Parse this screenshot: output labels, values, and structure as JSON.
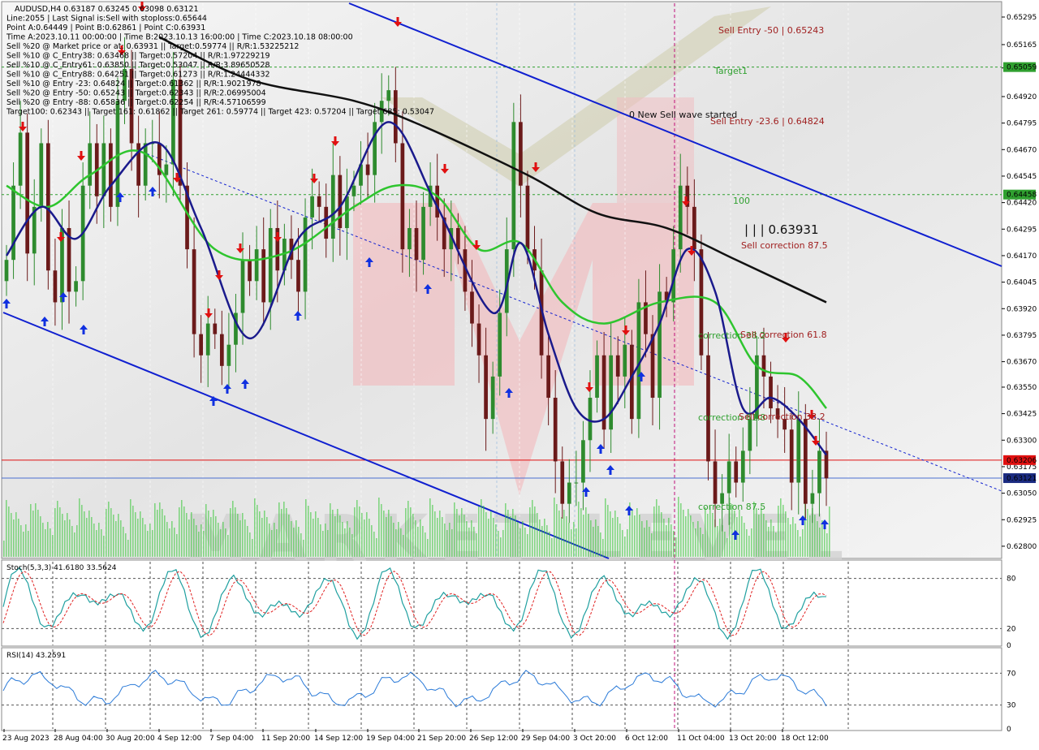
{
  "colors": {
    "bull": "#2e8b2e",
    "bear": "#6b1a1a",
    "ma_fast": "#1a1a8c",
    "ma_mid": "#2ec52e",
    "ma_slow": "#111111",
    "channel": "#1020d0",
    "sell_arrow": "#e01010",
    "buy_arrow": "#1030e0",
    "level_red": "#e01010",
    "level_blue": "#4a6fd0",
    "level_green": "#30a030",
    "ann_red": "#a02020",
    "ann_green": "#30a030"
  },
  "chart_data": {
    "type": "candlestick",
    "symbol": "AUDUSD",
    "timeframe": "H4",
    "price_axis": {
      "max": 0.6536,
      "min": 0.6275,
      "ticks": [
        "0.65295",
        "0.65165",
        "0.65055",
        "0.64920",
        "0.64795",
        "0.64670",
        "0.64545",
        "0.64420",
        "0.64295",
        "0.64170",
        "0.64045",
        "0.63920",
        "0.63795",
        "0.63670",
        "0.63550",
        "0.63425",
        "0.63300",
        "0.63175",
        "0.63050",
        "0.62925",
        "0.62800"
      ]
    },
    "x_labels": [
      "23 Aug 2023",
      "28 Aug 04:00",
      "30 Aug 20:00",
      "4 Sep 12:00",
      "7 Sep 04:00",
      "11 Sep 20:00",
      "14 Sep 12:00",
      "19 Sep 04:00",
      "21 Sep 20:00",
      "26 Sep 12:00",
      "29 Sep 04:00",
      "3 Oct 20:00",
      "6 Oct 12:00",
      "11 Oct 04:00",
      "13 Oct 20:00",
      "18 Oct 12:00"
    ],
    "closes": [
      0.6415,
      0.645,
      0.6475,
      0.6418,
      0.644,
      0.647,
      0.641,
      0.6395,
      0.643,
      0.64,
      0.6405,
      0.645,
      0.647,
      0.6445,
      0.647,
      0.644,
      0.649,
      0.6505,
      0.647,
      0.645,
      0.647,
      0.647,
      0.6455,
      0.646,
      0.65,
      0.645,
      0.642,
      0.638,
      0.637,
      0.6385,
      0.638,
      0.6365,
      0.6375,
      0.639,
      0.6415,
      0.6405,
      0.642,
      0.6395,
      0.643,
      0.641,
      0.6425,
      0.6415,
      0.64,
      0.6435,
      0.6445,
      0.644,
      0.6425,
      0.6455,
      0.643,
      0.6445,
      0.645,
      0.646,
      0.6455,
      0.648,
      0.649,
      0.6495,
      0.647,
      0.642,
      0.643,
      0.6415,
      0.644,
      0.645,
      0.6435,
      0.642,
      0.643,
      0.642,
      0.64,
      0.6385,
      0.637,
      0.634,
      0.636,
      0.639,
      0.642,
      0.648,
      0.645,
      0.642,
      0.641,
      0.637,
      0.635,
      0.632,
      0.63,
      0.631,
      0.631,
      0.633,
      0.635,
      0.637,
      0.6335,
      0.637,
      0.636,
      0.6375,
      0.634,
      0.6395,
      0.638,
      0.635,
      0.64,
      0.6395,
      0.642,
      0.645,
      0.644,
      0.642,
      0.637,
      0.632,
      0.63,
      0.6305,
      0.632,
      0.631,
      0.6325,
      0.634,
      0.637,
      0.636,
      0.6345,
      0.634,
      0.6335,
      0.631,
      0.634,
      0.63,
      0.6305,
      0.6325,
      0.6312
    ],
    "ma_fast_anchors": [
      [
        0,
        0.6417
      ],
      [
        5,
        0.644
      ],
      [
        10,
        0.6425
      ],
      [
        15,
        0.645
      ],
      [
        22,
        0.647
      ],
      [
        28,
        0.643
      ],
      [
        35,
        0.6378
      ],
      [
        42,
        0.6425
      ],
      [
        48,
        0.644
      ],
      [
        55,
        0.648
      ],
      [
        62,
        0.644
      ],
      [
        70,
        0.639
      ],
      [
        74,
        0.6423
      ],
      [
        78,
        0.638
      ],
      [
        82,
        0.6345
      ],
      [
        86,
        0.634
      ],
      [
        90,
        0.636
      ],
      [
        94,
        0.6385
      ],
      [
        98,
        0.642
      ],
      [
        102,
        0.64
      ],
      [
        106,
        0.6345
      ],
      [
        110,
        0.635
      ],
      [
        114,
        0.634
      ],
      [
        118,
        0.6323
      ]
    ],
    "ma_mid_anchors": [
      [
        0,
        0.645
      ],
      [
        6,
        0.644
      ],
      [
        12,
        0.6455
      ],
      [
        20,
        0.6465
      ],
      [
        30,
        0.642
      ],
      [
        40,
        0.6418
      ],
      [
        50,
        0.644
      ],
      [
        56,
        0.645
      ],
      [
        62,
        0.6445
      ],
      [
        68,
        0.642
      ],
      [
        74,
        0.6423
      ],
      [
        80,
        0.6395
      ],
      [
        86,
        0.6385
      ],
      [
        94,
        0.6395
      ],
      [
        102,
        0.6395
      ],
      [
        108,
        0.6365
      ],
      [
        114,
        0.636
      ],
      [
        118,
        0.6345
      ]
    ],
    "ma_slow_anchors": [
      [
        22,
        0.652
      ],
      [
        35,
        0.65
      ],
      [
        50,
        0.649
      ],
      [
        60,
        0.6478
      ],
      [
        75,
        0.6455
      ],
      [
        85,
        0.6437
      ],
      [
        95,
        0.643
      ],
      [
        105,
        0.6415
      ],
      [
        118,
        0.6395
      ]
    ],
    "info_lines": [
      "AUDUSD,H4  0.63187 0.63245 0.63098 0.63121",
      "Line:2055 | Last Signal is:Sell with stoploss:0.65644",
      "Point A:0.64449 | Point B:0.62861 | Point C:0.63931",
      "Time A:2023.10.11 00:00:00 | Time B:2023.10.13 16:00:00 | Time C:2023.10.18 08:00:00",
      "Sell %20 @ Market price or at: 0.63931 || Target:0.59774 || R/R:1.53225212",
      "Sell %10 @ C_Entry38: 0.63468 || Target:0.57204 || R/R:1.97229219",
      "Sell %10 @ C_Entry61: 0.63850 || Target:0.53047 || R/R:3.89650528",
      "Sell %10 @ C_Entry88: 0.64251 || Target:0.61273 || R/R:1.24444332",
      "Sell %10 @ Entry -23: 0.64824 || Target:0.61362 || R/R:1.9021978",
      "Sell %20 @ Entry -50: 0.65243 || Target:0.62343 || R/R:2.06995004",
      "Sell %20 @ Entry -88: 0.65836 || Target:0.62254 || R/R:4.57106599",
      "Target100: 0.62343 || Target 161: 0.61862 || Target 261: 0.59774 || Target 423: 0.57204 || Target 685: 0.53047"
    ],
    "annotations": [
      {
        "text": "Sell Entry -50 | 0.65243",
        "color": "red"
      },
      {
        "text": "Target1",
        "color": "green"
      },
      {
        "text": "0 New Sell wave started",
        "color": "black"
      },
      {
        "text": "Sell Entry -23.6 | 0.64824",
        "color": "red"
      },
      {
        "text": "100",
        "color": "green"
      },
      {
        "text": "| | | 0.63931",
        "color": "black"
      },
      {
        "text": "Sell correction 87.5",
        "color": "red"
      },
      {
        "text": "correction 38.2",
        "color": "green"
      },
      {
        "text": "Sell correction 61.8",
        "color": "red"
      },
      {
        "text": "correction 61.8",
        "color": "green"
      },
      {
        "text": "Sell correction 38.2",
        "color": "red"
      },
      {
        "text": "correction 87.5",
        "color": "green"
      }
    ],
    "watermark_text": "MARKET LEVEL",
    "level_labels": [
      "0.65059",
      "0.64458",
      "0.63206",
      "0.63121"
    ],
    "stoch": {
      "title": "Stoch(5,3,3) 41.6180 33.5624",
      "ticks": [
        "80",
        "20",
        "0"
      ]
    },
    "rsi": {
      "title": "RSI(14) 43.2591",
      "ticks": [
        "70",
        "30",
        "0"
      ]
    }
  }
}
